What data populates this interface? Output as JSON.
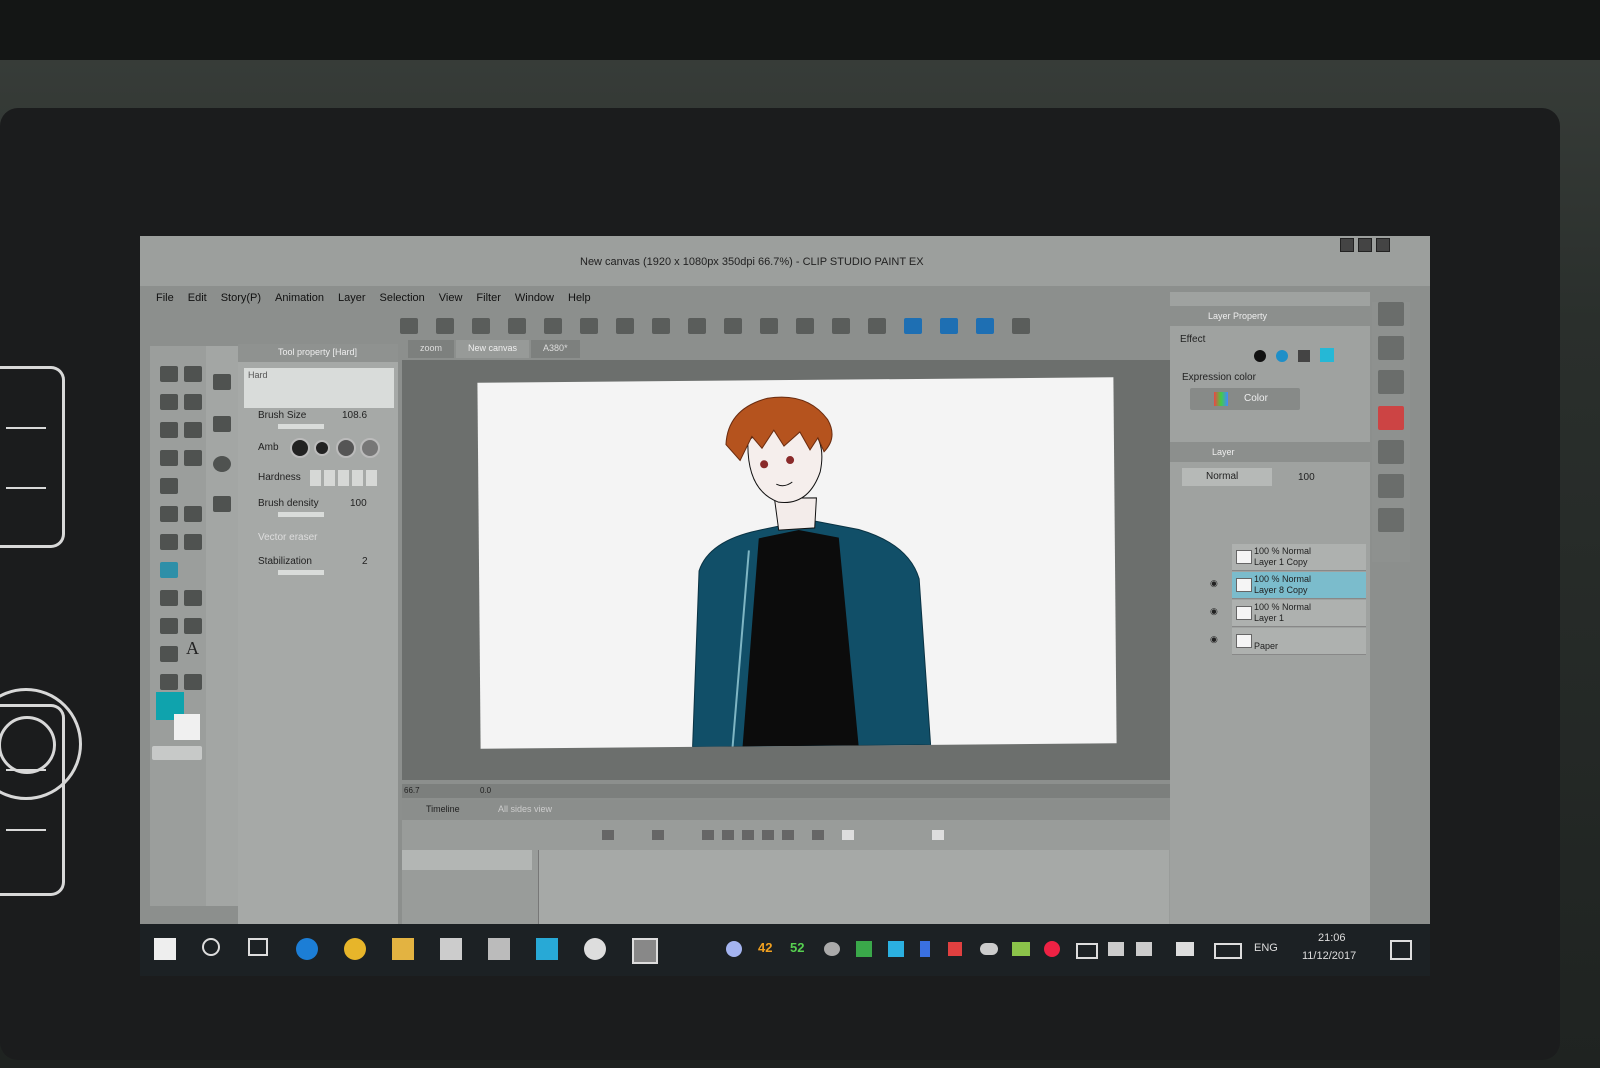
{
  "window": {
    "title": "New canvas (1920 x 1080px 350dpi 66.7%) - CLIP STUDIO PAINT EX"
  },
  "menu": [
    "File",
    "Edit",
    "Story(P)",
    "Animation",
    "Layer",
    "Selection",
    "View",
    "Filter",
    "Window",
    "Help"
  ],
  "document_tabs": [
    "zoom",
    "New canvas",
    "A380*"
  ],
  "tool_property": {
    "header": "Tool property [Hard]",
    "brush_name": "Hard",
    "brush_size_label": "Brush Size",
    "brush_size_value": "108.6",
    "ambient_label": "Amb",
    "hardness_label": "Hardness",
    "brush_density_label": "Brush density",
    "brush_density_value": "100",
    "vector_eraser_label": "Vector eraser",
    "stabilization_label": "Stabilization",
    "stabilization_value": "2"
  },
  "status": {
    "zoom": "66.7",
    "position": "0.0"
  },
  "timeline": {
    "tab_label": "Timeline",
    "tab2_label": "All sides view"
  },
  "layer_property": {
    "header": "Layer Property",
    "effect_label": "Effect",
    "expression_color_label": "Expression color",
    "expression_color_value": "Color"
  },
  "layer_panel": {
    "header": "Layer",
    "blend_mode": "Normal",
    "opacity": "100",
    "layers": [
      {
        "line1": "100 % Normal",
        "line2": "Layer 1 Copy",
        "selected": false
      },
      {
        "line1": "100 % Normal",
        "line2": "Layer 8 Copy",
        "selected": true
      },
      {
        "line1": "100 % Normal",
        "line2": "Layer 1",
        "selected": false
      },
      {
        "line1": "",
        "line2": "Paper",
        "selected": false
      }
    ]
  },
  "taskbar": {
    "badge_a": "42",
    "badge_b": "52",
    "language": "ENG",
    "time": "21:06",
    "date": "11/12/2017"
  },
  "colors": {
    "accent": "#0fa3ad",
    "hair": "#b5531e",
    "jacket": "#114f68",
    "shirt": "#0c0c0c"
  }
}
